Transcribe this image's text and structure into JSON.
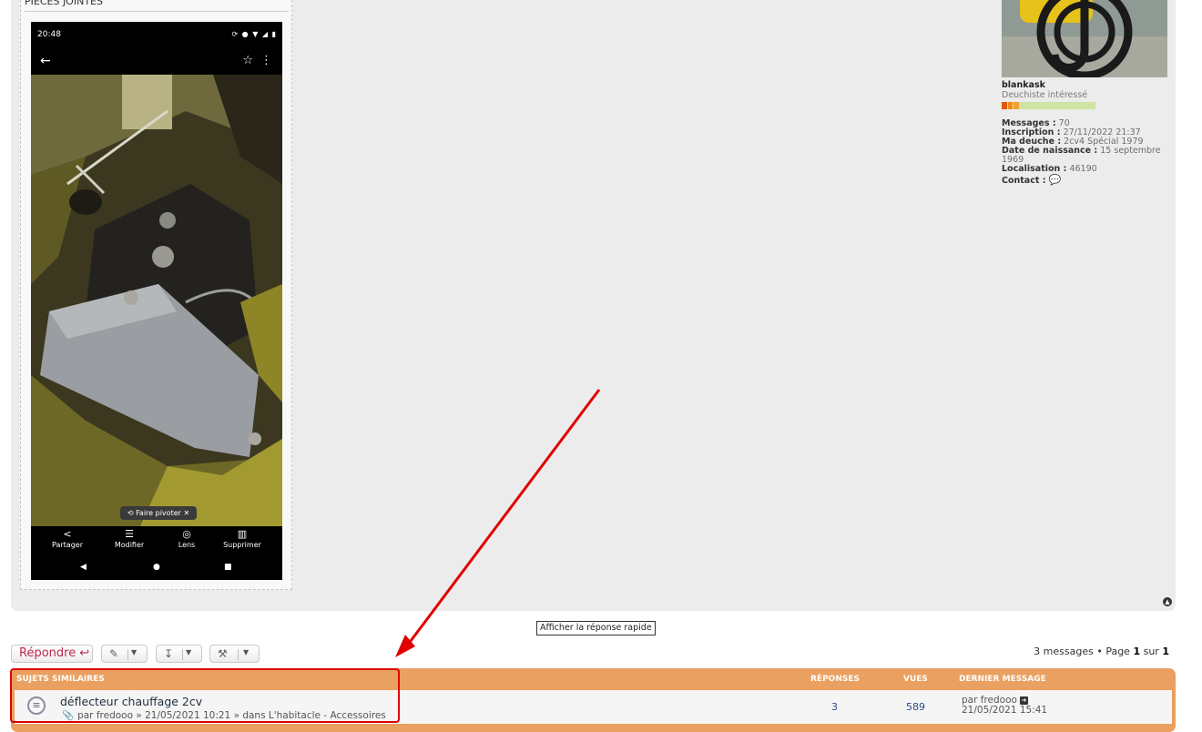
{
  "attachments": {
    "title": "PIÈCES JOINTES"
  },
  "phone_screenshot": {
    "time": "20:48",
    "status_icons": "⟳ ● ▼ ◢ ▮",
    "back_icon": "←",
    "star_icon": "☆",
    "more_icon": "⋮",
    "rotate_label": "Faire pivoter",
    "actions": [
      {
        "icon": "share-icon",
        "label": "Partager"
      },
      {
        "icon": "tune-icon",
        "label": "Modifier"
      },
      {
        "icon": "lens-icon",
        "label": "Lens"
      },
      {
        "icon": "trash-icon",
        "label": "Supprimer"
      }
    ]
  },
  "author": {
    "name": "blankask",
    "rank": "Deuchiste intéressé",
    "messages_label": "Messages :",
    "messages_value": "70",
    "inscription_label": "Inscription :",
    "inscription_value": "27/11/2022 21:37",
    "deuche_label": "Ma deuche :",
    "deuche_value": "2cv4 Spécial 1979",
    "birth_label": "Date de naissance :",
    "birth_value": "15 septembre 1969",
    "location_label": "Localisation :",
    "location_value": "46190",
    "contact_label": "Contact :"
  },
  "quick_reply": {
    "label": "Afficher la réponse rapide"
  },
  "toolbar": {
    "reply_label": "Répondre",
    "pagination_count": "3 messages • Page",
    "pagination_current": "1",
    "pagination_sep": "sur",
    "pagination_total": "1"
  },
  "similar_topics": {
    "header": "Sujets similaires",
    "col_replies": "Réponses",
    "col_views": "Vues",
    "col_last": "Dernier message",
    "rows": [
      {
        "title": "déflecteur chauffage 2cv",
        "meta": "par fredooo » 21/05/2021 10:21 » dans L'habitacle - Accessoires",
        "replies": "3",
        "views": "589",
        "last_by": "par fredooo",
        "last_date": "21/05/2021 15:41"
      }
    ]
  },
  "colors": {
    "panel_bg": "#ececec",
    "similar_header": "#e9a060",
    "reply_red": "#bc2a4d",
    "annotation_red": "#e00000"
  }
}
